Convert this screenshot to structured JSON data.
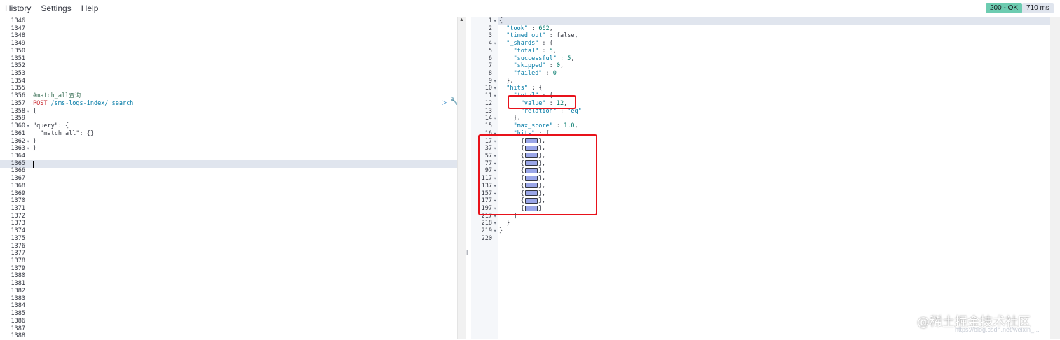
{
  "menu": {
    "items": [
      "History",
      "Settings",
      "Help"
    ]
  },
  "status": {
    "code": "200 - OK",
    "time": "710 ms"
  },
  "left_editor": {
    "lines": [
      {
        "n": "1346",
        "t": ""
      },
      {
        "n": "1347",
        "t": ""
      },
      {
        "n": "1348",
        "t": ""
      },
      {
        "n": "1349",
        "t": ""
      },
      {
        "n": "1350",
        "t": ""
      },
      {
        "n": "1351",
        "t": ""
      },
      {
        "n": "1352",
        "t": ""
      },
      {
        "n": "1353",
        "t": ""
      },
      {
        "n": "1354",
        "t": ""
      },
      {
        "n": "1355",
        "t": ""
      },
      {
        "n": "1356",
        "t": "#match_all查询",
        "k": "comment"
      },
      {
        "n": "1357",
        "method": "POST",
        "path": " /sms-logs-index/_search",
        "k": "request"
      },
      {
        "n": "1358",
        "t": "{",
        "fold": true
      },
      {
        "n": "1359",
        "t": ""
      },
      {
        "n": "1360",
        "t": "\"query\": {",
        "fold": true
      },
      {
        "n": "1361",
        "t": "  \"match_all\": {}"
      },
      {
        "n": "1362",
        "t": "}",
        "fold": true
      },
      {
        "n": "1363",
        "t": "}",
        "fold": true
      },
      {
        "n": "1364",
        "t": ""
      },
      {
        "n": "1365",
        "t": "",
        "active": true
      },
      {
        "n": "1366",
        "t": ""
      },
      {
        "n": "1367",
        "t": ""
      },
      {
        "n": "1368",
        "t": ""
      },
      {
        "n": "1369",
        "t": ""
      },
      {
        "n": "1370",
        "t": ""
      },
      {
        "n": "1371",
        "t": ""
      },
      {
        "n": "1372",
        "t": ""
      },
      {
        "n": "1373",
        "t": ""
      },
      {
        "n": "1374",
        "t": ""
      },
      {
        "n": "1375",
        "t": ""
      },
      {
        "n": "1376",
        "t": ""
      },
      {
        "n": "1377",
        "t": ""
      },
      {
        "n": "1378",
        "t": ""
      },
      {
        "n": "1379",
        "t": ""
      },
      {
        "n": "1380",
        "t": ""
      },
      {
        "n": "1381",
        "t": ""
      },
      {
        "n": "1382",
        "t": ""
      },
      {
        "n": "1383",
        "t": ""
      },
      {
        "n": "1384",
        "t": ""
      },
      {
        "n": "1385",
        "t": ""
      },
      {
        "n": "1386",
        "t": ""
      },
      {
        "n": "1387",
        "t": ""
      },
      {
        "n": "1388",
        "t": ""
      }
    ]
  },
  "right_output": {
    "lines": [
      {
        "n": "1",
        "fold": true,
        "t": "{"
      },
      {
        "n": "2",
        "t": "  \"took\" : 662,"
      },
      {
        "n": "3",
        "t": "  \"timed_out\" : false,"
      },
      {
        "n": "4",
        "fold": true,
        "t": "  \"_shards\" : {"
      },
      {
        "n": "5",
        "t": "    \"total\" : 5,"
      },
      {
        "n": "6",
        "t": "    \"successful\" : 5,"
      },
      {
        "n": "7",
        "t": "    \"skipped\" : 0,"
      },
      {
        "n": "8",
        "t": "    \"failed\" : 0"
      },
      {
        "n": "9",
        "fold": true,
        "t": "  },"
      },
      {
        "n": "10",
        "fold": true,
        "t": "  \"hits\" : {"
      },
      {
        "n": "11",
        "fold": true,
        "t": "    \"total\" : {"
      },
      {
        "n": "12",
        "t": "      \"value\" : 12,"
      },
      {
        "n": "13",
        "t": "      \"relation\" : \"eq\""
      },
      {
        "n": "14",
        "fold": true,
        "t": "    },"
      },
      {
        "n": "15",
        "t": "    \"max_score\" : 1.0,"
      },
      {
        "n": "16",
        "fold": true,
        "t": "    \"hits\" : ["
      },
      {
        "n": "17",
        "fold": true,
        "t": "      {",
        "c": true,
        "e": "},"
      },
      {
        "n": "37",
        "fold": true,
        "t": "      {",
        "c": true,
        "e": "},"
      },
      {
        "n": "57",
        "fold": true,
        "t": "      {",
        "c": true,
        "e": "},"
      },
      {
        "n": "77",
        "fold": true,
        "t": "      {",
        "c": true,
        "e": "},"
      },
      {
        "n": "97",
        "fold": true,
        "t": "      {",
        "c": true,
        "e": "},"
      },
      {
        "n": "117",
        "fold": true,
        "t": "      {",
        "c": true,
        "e": "},"
      },
      {
        "n": "137",
        "fold": true,
        "t": "      {",
        "c": true,
        "e": "},"
      },
      {
        "n": "157",
        "fold": true,
        "t": "      {",
        "c": true,
        "e": "},"
      },
      {
        "n": "177",
        "fold": true,
        "t": "      {",
        "c": true,
        "e": "},"
      },
      {
        "n": "197",
        "fold": true,
        "t": "      {",
        "c": true,
        "e": "}"
      },
      {
        "n": "217",
        "fold": true,
        "t": "    ]"
      },
      {
        "n": "218",
        "fold": true,
        "t": "  }"
      },
      {
        "n": "219",
        "fold": true,
        "t": "}"
      },
      {
        "n": "220",
        "t": ""
      }
    ]
  },
  "watermark": {
    "main": "@稀土掘金技术社区",
    "sub": "https://blog.csdn.net/weixin_..."
  },
  "colors": {
    "status_ok": "#6dccb1",
    "highlight_box": "#e8121b",
    "active_line": "#e0e5ee"
  }
}
